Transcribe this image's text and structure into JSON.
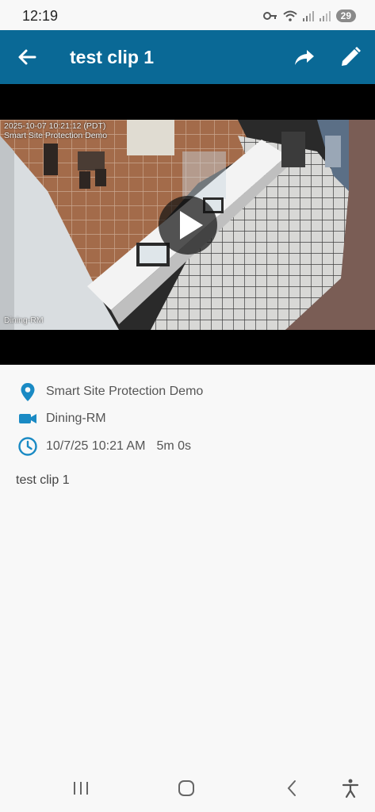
{
  "status_bar": {
    "time": "12:19",
    "battery": "29"
  },
  "header": {
    "title": "test clip 1"
  },
  "video": {
    "timestamp_line1": "2025-10-07 10:21:12 (PDT)",
    "timestamp_line2": "Smart Site Protection Demo",
    "camera_overlay": "Dining-RM"
  },
  "details": {
    "site": "Smart Site Protection Demo",
    "camera": "Dining-RM",
    "datetime": "10/7/25 10:21 AM",
    "duration": "5m 0s"
  },
  "description": "test clip 1",
  "colors": {
    "accent": "#0a6996",
    "icon": "#1a8ac4"
  },
  "icons": [
    "back-arrow-icon",
    "share-icon",
    "edit-pencil-icon",
    "play-icon",
    "location-pin-icon",
    "video-camera-icon",
    "clock-icon"
  ]
}
